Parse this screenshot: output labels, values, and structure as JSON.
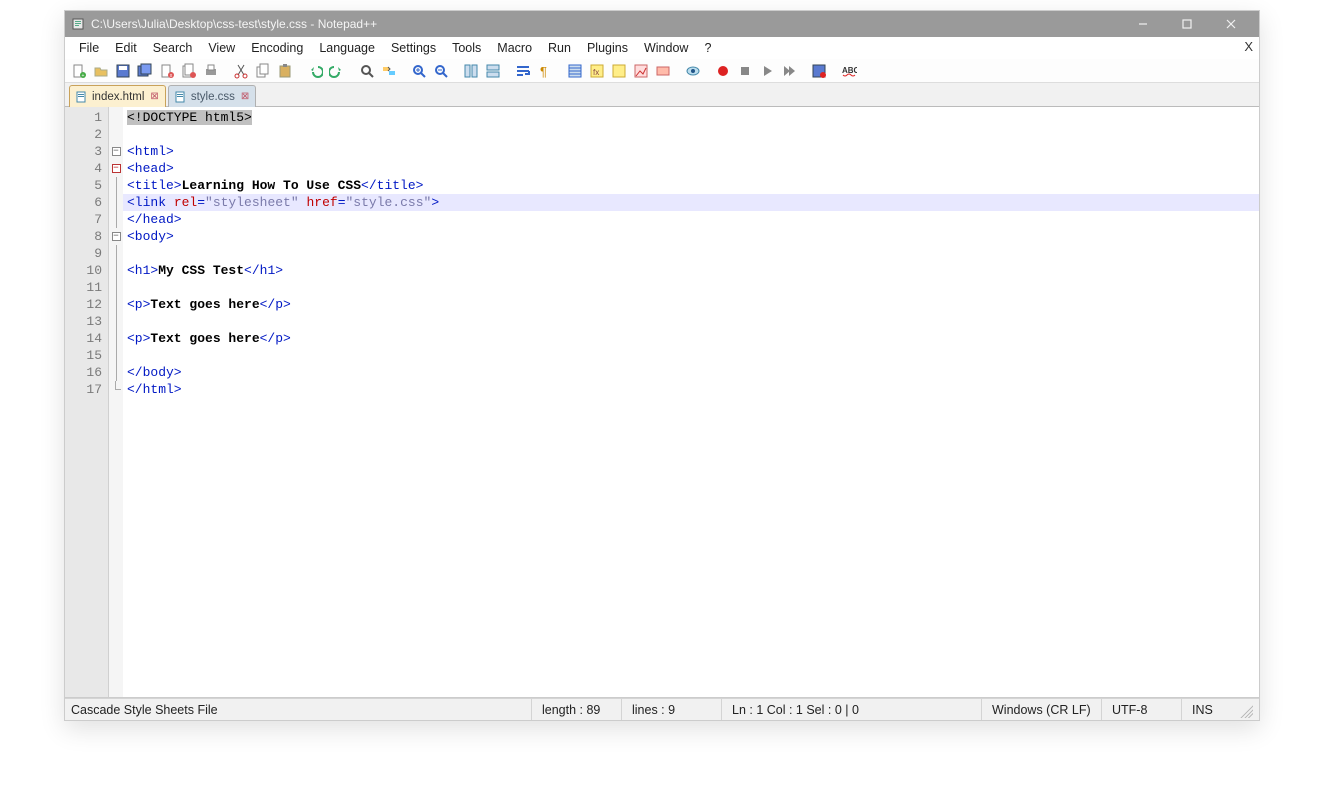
{
  "window": {
    "title": "C:\\Users\\Julia\\Desktop\\css-test\\style.css - Notepad++"
  },
  "menu": {
    "items": [
      "File",
      "Edit",
      "Search",
      "View",
      "Encoding",
      "Language",
      "Settings",
      "Tools",
      "Macro",
      "Run",
      "Plugins",
      "Window",
      "?"
    ]
  },
  "toolbar": {
    "icons": [
      "new-file",
      "open-file",
      "save",
      "save-all",
      "close-file",
      "close-all",
      "print",
      "sep",
      "cut",
      "copy",
      "paste",
      "sep",
      "undo",
      "redo",
      "sep",
      "find",
      "replace",
      "sep",
      "zoom-in",
      "zoom-out",
      "sep",
      "sync-v",
      "sync-h",
      "sep",
      "word-wrap",
      "pilcrow",
      "sep",
      "indent-guide",
      "user-lang",
      "folder",
      "doc-map",
      "func-list",
      "sep",
      "monitor",
      "sep",
      "record",
      "stop",
      "play",
      "play-multi",
      "sep",
      "save-macro",
      "sep",
      "spellcheck"
    ]
  },
  "tabs": {
    "items": [
      {
        "label": "index.html",
        "active": true
      },
      {
        "label": "style.css",
        "active": false
      }
    ]
  },
  "editor": {
    "highlight_line": 6,
    "lines": [
      {
        "n": 1,
        "fold": "",
        "seg": [
          {
            "c": "sel",
            "t": "<!DOCTYPE html5>"
          }
        ]
      },
      {
        "n": 2,
        "fold": "",
        "seg": []
      },
      {
        "n": 3,
        "fold": "box",
        "seg": [
          {
            "c": "tagc",
            "t": "<html>"
          }
        ]
      },
      {
        "n": 4,
        "fold": "boxred",
        "seg": [
          {
            "c": "tagc",
            "t": "<head>"
          }
        ]
      },
      {
        "n": 5,
        "fold": "bar",
        "seg": [
          {
            "c": "tagc",
            "t": "<title>"
          },
          {
            "c": "txt",
            "t": "Learning How To Use CSS"
          },
          {
            "c": "tagc",
            "t": "</title>"
          }
        ]
      },
      {
        "n": 6,
        "fold": "bar",
        "seg": [
          {
            "c": "tagc",
            "t": "<link "
          },
          {
            "c": "attr",
            "t": "rel"
          },
          {
            "c": "tagc",
            "t": "="
          },
          {
            "c": "str",
            "t": "\"stylesheet\""
          },
          {
            "c": "tagc",
            "t": " "
          },
          {
            "c": "attr",
            "t": "href"
          },
          {
            "c": "tagc",
            "t": "="
          },
          {
            "c": "str",
            "t": "\"style.css\""
          },
          {
            "c": "tagc",
            "t": ">"
          }
        ]
      },
      {
        "n": 7,
        "fold": "bar",
        "seg": [
          {
            "c": "tagc",
            "t": "</head>"
          }
        ]
      },
      {
        "n": 8,
        "fold": "box",
        "seg": [
          {
            "c": "tagc",
            "t": "<body>"
          }
        ]
      },
      {
        "n": 9,
        "fold": "bar",
        "seg": []
      },
      {
        "n": 10,
        "fold": "bar",
        "seg": [
          {
            "c": "tagc",
            "t": "<h1>"
          },
          {
            "c": "txt",
            "t": "My CSS Test"
          },
          {
            "c": "tagc",
            "t": "</h1>"
          }
        ]
      },
      {
        "n": 11,
        "fold": "bar",
        "seg": []
      },
      {
        "n": 12,
        "fold": "bar",
        "seg": [
          {
            "c": "tagc",
            "t": "<p>"
          },
          {
            "c": "txt",
            "t": "Text goes here"
          },
          {
            "c": "tagc",
            "t": "</p>"
          }
        ]
      },
      {
        "n": 13,
        "fold": "bar",
        "seg": []
      },
      {
        "n": 14,
        "fold": "bar",
        "seg": [
          {
            "c": "tagc",
            "t": "<p>"
          },
          {
            "c": "txt",
            "t": "Text goes here"
          },
          {
            "c": "tagc",
            "t": "</p>"
          }
        ]
      },
      {
        "n": 15,
        "fold": "bar",
        "seg": []
      },
      {
        "n": 16,
        "fold": "bar",
        "seg": [
          {
            "c": "tagc",
            "t": "</body>"
          }
        ]
      },
      {
        "n": 17,
        "fold": "end",
        "seg": [
          {
            "c": "tagc",
            "t": "</html>"
          }
        ]
      }
    ]
  },
  "status": {
    "filetype": "Cascade Style Sheets File",
    "length": "length : 89",
    "lines": "lines : 9",
    "pos": "Ln : 1    Col : 1    Sel : 0 | 0",
    "eol": "Windows (CR LF)",
    "encoding": "UTF-8",
    "mode": "INS"
  }
}
